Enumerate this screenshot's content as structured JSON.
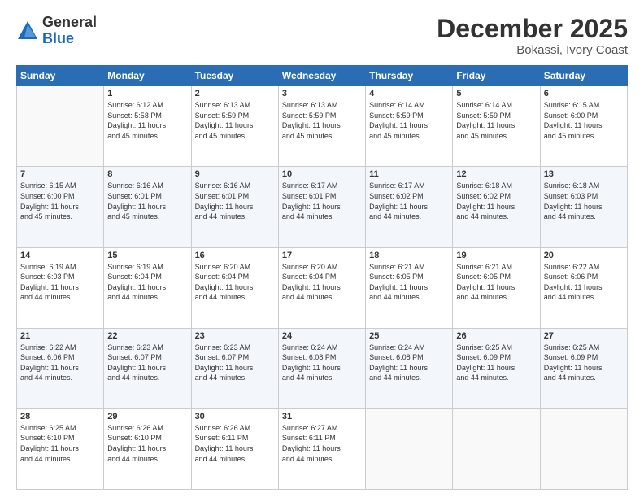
{
  "header": {
    "logo_general": "General",
    "logo_blue": "Blue",
    "month_title": "December 2025",
    "location": "Bokassi, Ivory Coast"
  },
  "days_of_week": [
    "Sunday",
    "Monday",
    "Tuesday",
    "Wednesday",
    "Thursday",
    "Friday",
    "Saturday"
  ],
  "weeks": [
    [
      {
        "day": "",
        "info": ""
      },
      {
        "day": "1",
        "info": "Sunrise: 6:12 AM\nSunset: 5:58 PM\nDaylight: 11 hours\nand 45 minutes."
      },
      {
        "day": "2",
        "info": "Sunrise: 6:13 AM\nSunset: 5:59 PM\nDaylight: 11 hours\nand 45 minutes."
      },
      {
        "day": "3",
        "info": "Sunrise: 6:13 AM\nSunset: 5:59 PM\nDaylight: 11 hours\nand 45 minutes."
      },
      {
        "day": "4",
        "info": "Sunrise: 6:14 AM\nSunset: 5:59 PM\nDaylight: 11 hours\nand 45 minutes."
      },
      {
        "day": "5",
        "info": "Sunrise: 6:14 AM\nSunset: 5:59 PM\nDaylight: 11 hours\nand 45 minutes."
      },
      {
        "day": "6",
        "info": "Sunrise: 6:15 AM\nSunset: 6:00 PM\nDaylight: 11 hours\nand 45 minutes."
      }
    ],
    [
      {
        "day": "7",
        "info": "Sunrise: 6:15 AM\nSunset: 6:00 PM\nDaylight: 11 hours\nand 45 minutes."
      },
      {
        "day": "8",
        "info": "Sunrise: 6:16 AM\nSunset: 6:01 PM\nDaylight: 11 hours\nand 45 minutes."
      },
      {
        "day": "9",
        "info": "Sunrise: 6:16 AM\nSunset: 6:01 PM\nDaylight: 11 hours\nand 44 minutes."
      },
      {
        "day": "10",
        "info": "Sunrise: 6:17 AM\nSunset: 6:01 PM\nDaylight: 11 hours\nand 44 minutes."
      },
      {
        "day": "11",
        "info": "Sunrise: 6:17 AM\nSunset: 6:02 PM\nDaylight: 11 hours\nand 44 minutes."
      },
      {
        "day": "12",
        "info": "Sunrise: 6:18 AM\nSunset: 6:02 PM\nDaylight: 11 hours\nand 44 minutes."
      },
      {
        "day": "13",
        "info": "Sunrise: 6:18 AM\nSunset: 6:03 PM\nDaylight: 11 hours\nand 44 minutes."
      }
    ],
    [
      {
        "day": "14",
        "info": "Sunrise: 6:19 AM\nSunset: 6:03 PM\nDaylight: 11 hours\nand 44 minutes."
      },
      {
        "day": "15",
        "info": "Sunrise: 6:19 AM\nSunset: 6:04 PM\nDaylight: 11 hours\nand 44 minutes."
      },
      {
        "day": "16",
        "info": "Sunrise: 6:20 AM\nSunset: 6:04 PM\nDaylight: 11 hours\nand 44 minutes."
      },
      {
        "day": "17",
        "info": "Sunrise: 6:20 AM\nSunset: 6:04 PM\nDaylight: 11 hours\nand 44 minutes."
      },
      {
        "day": "18",
        "info": "Sunrise: 6:21 AM\nSunset: 6:05 PM\nDaylight: 11 hours\nand 44 minutes."
      },
      {
        "day": "19",
        "info": "Sunrise: 6:21 AM\nSunset: 6:05 PM\nDaylight: 11 hours\nand 44 minutes."
      },
      {
        "day": "20",
        "info": "Sunrise: 6:22 AM\nSunset: 6:06 PM\nDaylight: 11 hours\nand 44 minutes."
      }
    ],
    [
      {
        "day": "21",
        "info": "Sunrise: 6:22 AM\nSunset: 6:06 PM\nDaylight: 11 hours\nand 44 minutes."
      },
      {
        "day": "22",
        "info": "Sunrise: 6:23 AM\nSunset: 6:07 PM\nDaylight: 11 hours\nand 44 minutes."
      },
      {
        "day": "23",
        "info": "Sunrise: 6:23 AM\nSunset: 6:07 PM\nDaylight: 11 hours\nand 44 minutes."
      },
      {
        "day": "24",
        "info": "Sunrise: 6:24 AM\nSunset: 6:08 PM\nDaylight: 11 hours\nand 44 minutes."
      },
      {
        "day": "25",
        "info": "Sunrise: 6:24 AM\nSunset: 6:08 PM\nDaylight: 11 hours\nand 44 minutes."
      },
      {
        "day": "26",
        "info": "Sunrise: 6:25 AM\nSunset: 6:09 PM\nDaylight: 11 hours\nand 44 minutes."
      },
      {
        "day": "27",
        "info": "Sunrise: 6:25 AM\nSunset: 6:09 PM\nDaylight: 11 hours\nand 44 minutes."
      }
    ],
    [
      {
        "day": "28",
        "info": "Sunrise: 6:25 AM\nSunset: 6:10 PM\nDaylight: 11 hours\nand 44 minutes."
      },
      {
        "day": "29",
        "info": "Sunrise: 6:26 AM\nSunset: 6:10 PM\nDaylight: 11 hours\nand 44 minutes."
      },
      {
        "day": "30",
        "info": "Sunrise: 6:26 AM\nSunset: 6:11 PM\nDaylight: 11 hours\nand 44 minutes."
      },
      {
        "day": "31",
        "info": "Sunrise: 6:27 AM\nSunset: 6:11 PM\nDaylight: 11 hours\nand 44 minutes."
      },
      {
        "day": "",
        "info": ""
      },
      {
        "day": "",
        "info": ""
      },
      {
        "day": "",
        "info": ""
      }
    ]
  ]
}
